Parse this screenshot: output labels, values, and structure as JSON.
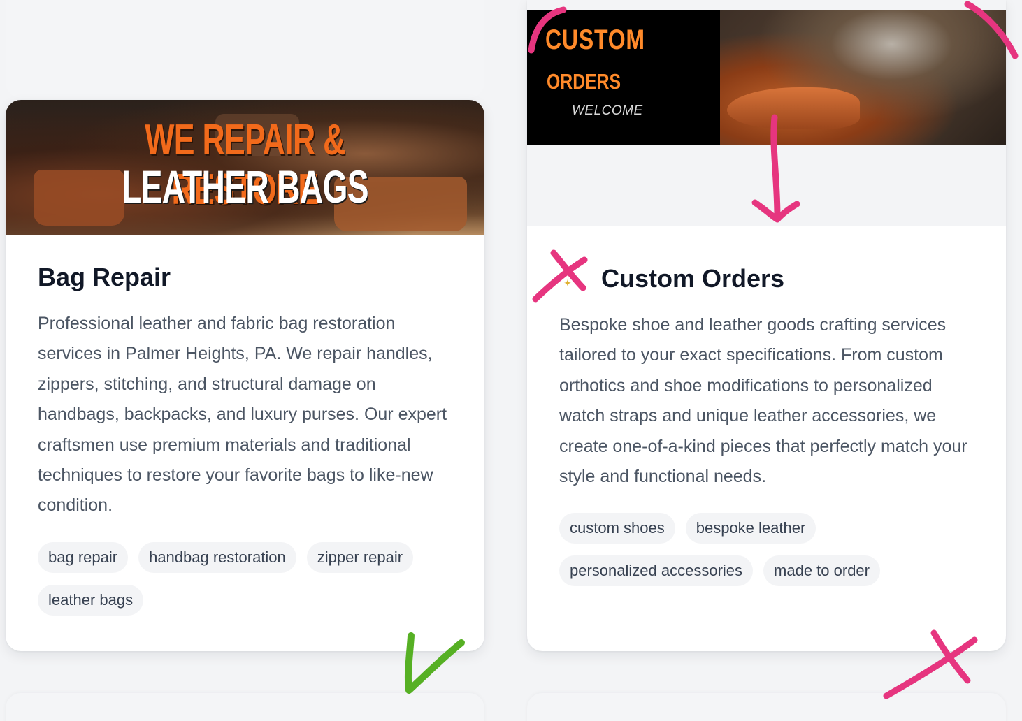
{
  "cards": [
    {
      "banner": {
        "line1": "WE REPAIR & RESTORE",
        "line2": "LEATHER BAGS"
      },
      "title": "Bag Repair",
      "description": "Professional leather and fabric bag restoration services in Palmer Heights, PA. We repair handles, zippers, stitching, and structural damage on handbags, backpacks, and luxury purses. Our expert craftsmen use premium materials and traditional techniques to restore your favorite bags to like-new condition.",
      "tags": [
        "bag repair",
        "handbag restoration",
        "zipper repair",
        "leather bags"
      ]
    },
    {
      "banner": {
        "line1": "CUSTOM",
        "line2": "ORDERS",
        "line3": "WELCOME"
      },
      "title": "Custom Orders",
      "description": "Bespoke shoe and leather goods crafting services tailored to your exact specifications. From custom orthotics and shoe modifications to personalized watch straps and unique leather accessories, we create one-of-a-kind pieces that perfectly match your style and functional needs.",
      "tags": [
        "custom shoes",
        "bespoke leather",
        "personalized accessories",
        "made to order"
      ]
    }
  ],
  "annotations": {
    "pink": "#e6357f",
    "green": "#56b024"
  }
}
